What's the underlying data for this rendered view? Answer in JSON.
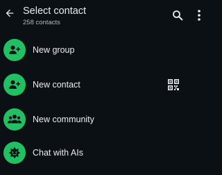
{
  "header": {
    "title": "Select contact",
    "subtitle": "258 contacts",
    "back_icon": "arrow-left-icon",
    "search_icon": "search-icon",
    "menu_icon": "more-vertical-icon"
  },
  "actions": [
    {
      "label": "New group",
      "icon": "group-add-icon"
    },
    {
      "label": "New contact",
      "icon": "person-add-icon",
      "trailing_icon": "qr-code-icon"
    },
    {
      "label": "New community",
      "icon": "community-icon"
    },
    {
      "label": "Chat with AIs",
      "icon": "ai-chat-icon"
    }
  ],
  "colors": {
    "background": "#0b1014",
    "accent": "#21c063",
    "text_primary": "#e9edef",
    "text_secondary": "#aebac1"
  }
}
